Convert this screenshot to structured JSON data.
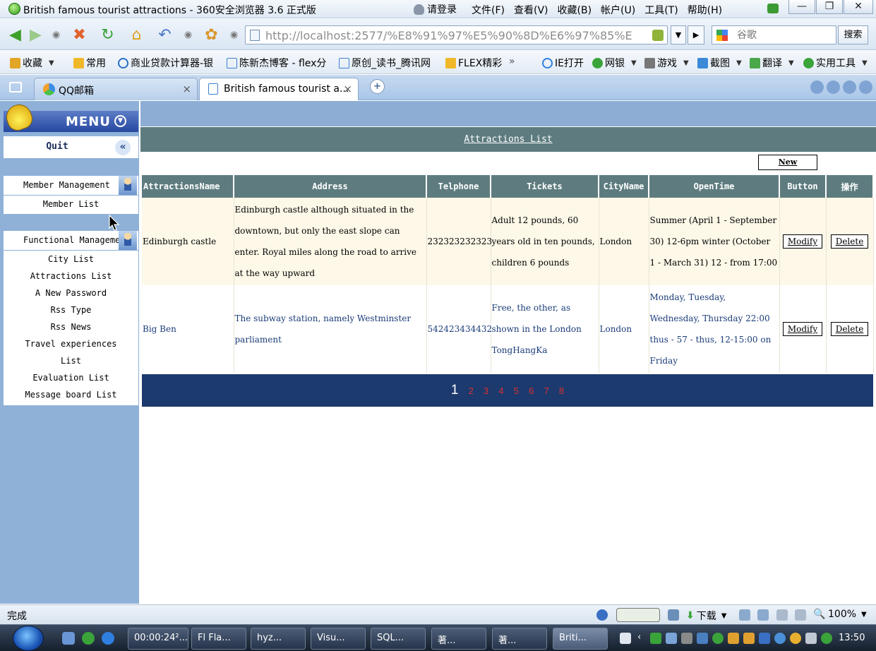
{
  "window": {
    "title": "British famous tourist attractions - 360安全浏览器 3.6 正式版",
    "login": "请登录",
    "menus": [
      "文件(F)",
      "查看(V)",
      "收藏(B)",
      "帐户(U)",
      "工具(T)",
      "帮助(H)"
    ],
    "controls": [
      "—",
      "❐",
      "✕"
    ]
  },
  "navbar": {
    "url": "http://localhost:2577/%E8%91%97%E5%90%8D%E6%97%85%E6%",
    "search_placeholder": "谷歌",
    "search_button": "搜索"
  },
  "favorites": [
    {
      "label": "收藏",
      "color": "#e2a526"
    },
    {
      "label": "常用",
      "color": "#f0b829"
    },
    {
      "label": "商业贷款计算器-银",
      "color": "#2a6fc4"
    },
    {
      "label": "陈新杰博客 - flex分",
      "color": "#3d7fd1"
    },
    {
      "label": "原创_读书_腾讯网",
      "color": "#3d7fd1"
    },
    {
      "label": "FLEX精彩",
      "color": "#f0b829"
    },
    {
      "label": "»",
      "color": ""
    },
    {
      "label": "IE打开",
      "color": "#2f7fe0"
    },
    {
      "label": "网银",
      "color": "#3aa33a"
    },
    {
      "label": "游戏",
      "color": "#777"
    },
    {
      "label": "截图",
      "color": "#3b8ad8"
    },
    {
      "label": "翻译",
      "color": "#4aa84a"
    },
    {
      "label": "实用工具",
      "color": "#3aa33a"
    }
  ],
  "tabs": [
    {
      "label": "QQ邮箱",
      "close": "×"
    },
    {
      "label": "British famous tourist a...",
      "close": "×"
    }
  ],
  "sidebar": {
    "menu_title": "MENU",
    "quit": "Quit",
    "collapse": "«",
    "sections": [
      {
        "title": "Member Management",
        "items": [
          "Member List"
        ]
      },
      {
        "title": "Functional Management",
        "items": [
          "City List",
          "Attractions List",
          "A New Password",
          "Rss Type",
          "Rss News",
          "Travel experiences",
          "List",
          "Evaluation List",
          "Message board List"
        ]
      }
    ]
  },
  "content": {
    "list_title": "Attractions List",
    "new_button": "New",
    "columns": [
      "AttractionsName",
      "Address",
      "Telphone",
      "Tickets",
      "CityName",
      "OpenTime",
      "Button",
      "操作"
    ],
    "rows": [
      {
        "name": "Edinburgh castle",
        "address": "Edinburgh castle although situated in the downtown, but only the east slope can enter. Royal miles along the road to arrive at the way upward",
        "telphone": "232323232323",
        "tickets": "Adult 12 pounds, 60 years old in ten pounds, children 6 pounds",
        "city": "London",
        "opentime": "Summer (April 1 - September 30) 12-6pm winter (October 1 - March 31) 12 - from 17:00",
        "modify": "Modify",
        "delete": "Delete"
      },
      {
        "name": "Big Ben",
        "address": "The subway station, namely Westminster parliament",
        "telphone": "542423434432",
        "tickets": "Free, the other, as shown in the London TongHangKa",
        "city": "London",
        "opentime": "Monday, Tuesday, Wednesday, Thursday 22:00 thus - 57 - thus, 12-15:00 on Friday",
        "modify": "Modify",
        "delete": "Delete"
      }
    ],
    "pages": [
      "1",
      "2",
      "3",
      "4",
      "5",
      "6",
      "7",
      "8"
    ],
    "current_page": "1"
  },
  "status": {
    "text": "完成",
    "download": "下载",
    "zoom": "100%"
  },
  "taskbar": {
    "tasks": [
      "00:00:24²...",
      "Fl Fla...",
      "hyz...",
      "Visu...",
      "SQL...",
      "著...",
      "著...",
      "Briti..."
    ],
    "time": "13:50"
  }
}
